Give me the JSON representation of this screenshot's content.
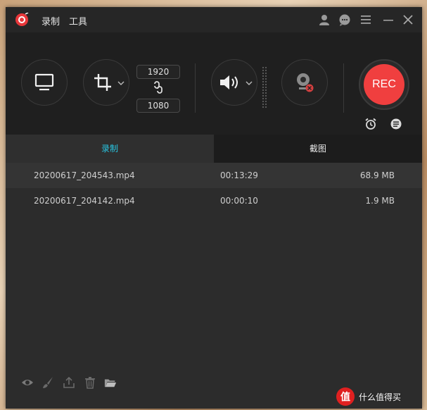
{
  "titlebar": {
    "menu_record": "录制",
    "menu_tools": "工具",
    "icons": [
      "user-icon",
      "chat-icon",
      "menu-icon",
      "minimize-icon",
      "close-icon"
    ]
  },
  "toolbar": {
    "width_value": "1920",
    "height_value": "1080",
    "rec_label": "REC"
  },
  "tabs": {
    "recordings": "录制",
    "screenshots": "截图",
    "active_color": "#29c4e0"
  },
  "files": [
    {
      "name": "20200617_204543.mp4",
      "duration": "00:13:29",
      "size": "68.9 MB"
    },
    {
      "name": "20200617_204142.mp4",
      "duration": "00:00:10",
      "size": "1.9 MB"
    }
  ],
  "bottom_icons": [
    "eye-icon",
    "brush-icon",
    "share-icon",
    "trash-icon",
    "folder-icon"
  ],
  "watermark": {
    "badge": "值",
    "text": "什么值得买"
  },
  "colors": {
    "rec_red": "#f03f3f",
    "window_bg": "#2c2c2c"
  }
}
